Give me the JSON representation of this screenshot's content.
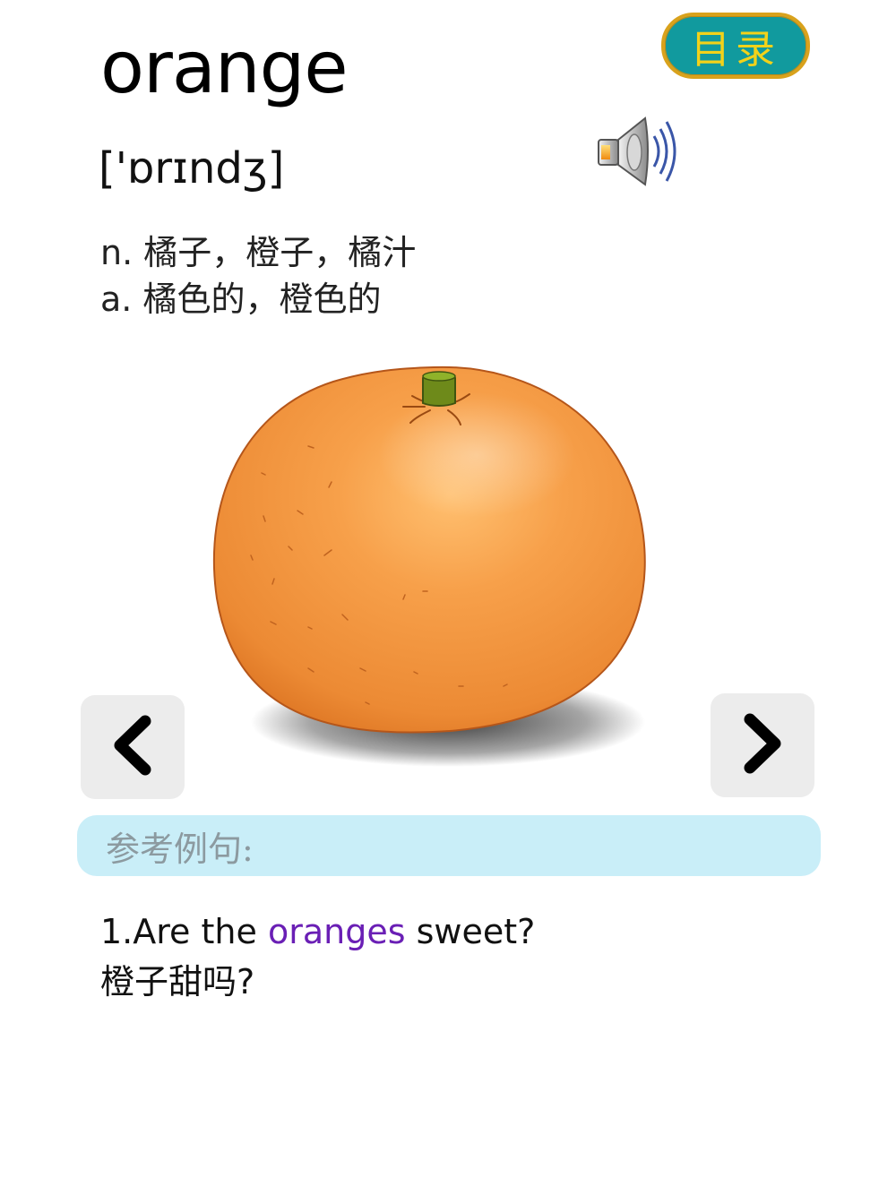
{
  "entry": {
    "word": "orange",
    "phonetic": "['ɒrɪndʒ]",
    "definitions": [
      "n. 橘子，橙子，橘汁",
      "a. 橘色的，橙色的"
    ]
  },
  "toolbar": {
    "catalog_label": "目录",
    "speaker_icon": "speaker-icon"
  },
  "navigation": {
    "prev_icon": "chevron-left-icon",
    "next_icon": "chevron-right-icon"
  },
  "examples": {
    "header": "参考例句:",
    "items": [
      {
        "before": "1.Are the ",
        "highlight": "oranges",
        "after": " sweet?",
        "translation": "橙子甜吗?"
      }
    ]
  },
  "colors": {
    "catalog_bg": "#119a9e",
    "catalog_border": "#d9a21c",
    "catalog_text": "#f2d21a",
    "highlight": "#6a1fb5",
    "example_header_bg": "#c9eef8",
    "fruit": "#f39a45"
  }
}
